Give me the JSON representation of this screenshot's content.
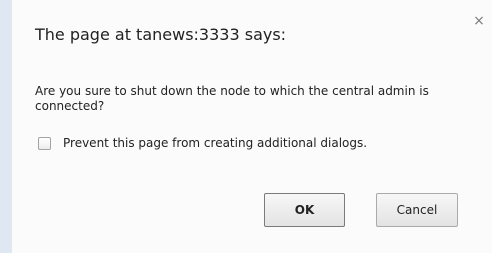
{
  "dialog": {
    "title": "The page at tanews:3333 says:",
    "close_glyph": "×",
    "message": "Are you sure to shut down the node to which the central admin is connected?",
    "prevent_label": "Prevent this page from creating additional dialogs.",
    "prevent_checked": false,
    "ok_label": "OK",
    "cancel_label": "Cancel"
  }
}
